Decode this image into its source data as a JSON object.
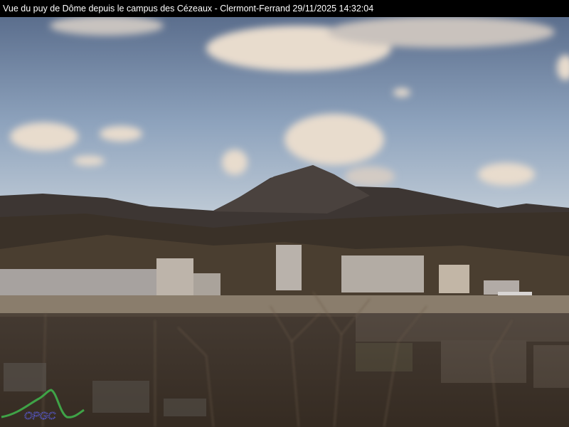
{
  "caption": {
    "title": "Vue du puy de Dôme depuis le campus des Cézeaux - Clermont-Ferrand",
    "timestamp": "29/11/2025 14:32:04"
  },
  "logo": {
    "text": "OPGC"
  },
  "colors": {
    "sky_top": "#5d7190",
    "sky_bottom": "#b9c7d6",
    "mountain": "#3b3430",
    "city": "#b7aa98"
  }
}
